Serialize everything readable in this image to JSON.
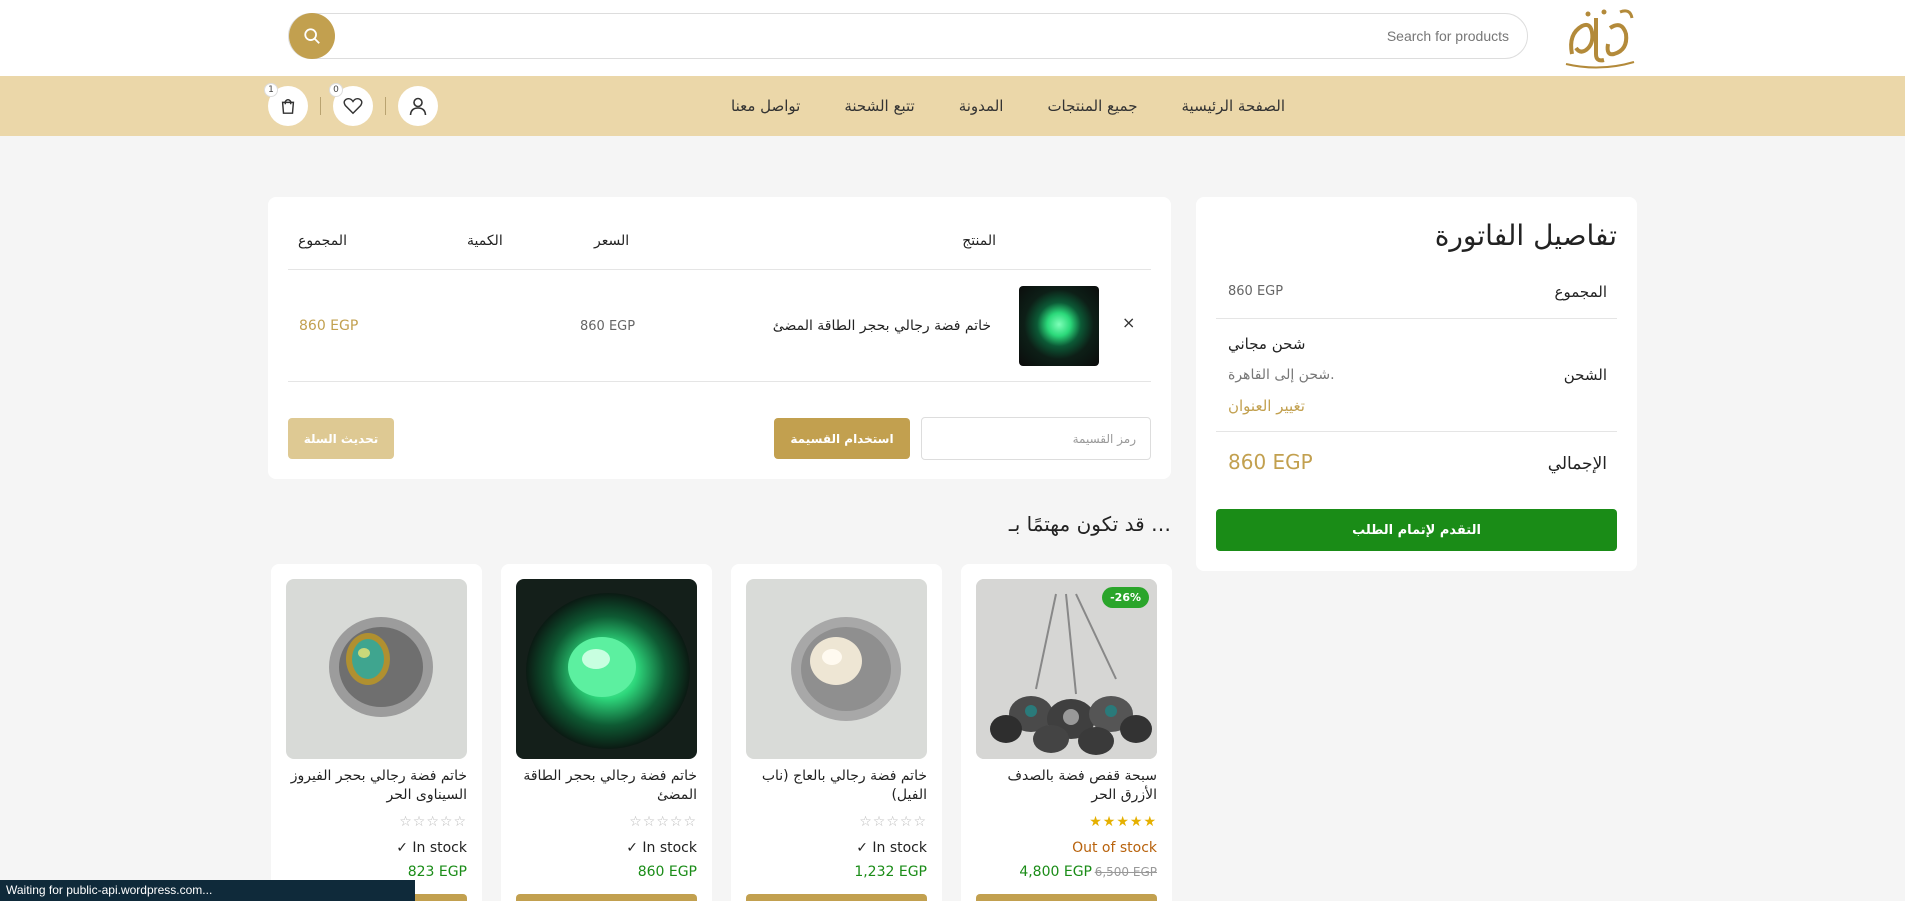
{
  "header": {
    "search_placeholder": "Search for products",
    "logo_text": "الغرقي"
  },
  "nav": {
    "items": [
      "الصفحة الرئيسية",
      "جميع المنتجات",
      "المدونة",
      "تتبع الشحنة",
      "تواصل معنا"
    ],
    "wishlist_count": "0",
    "cart_count": "1"
  },
  "cart": {
    "headers": {
      "product": "المنتج",
      "price": "السعر",
      "quantity": "الكمية",
      "subtotal": "المجموع"
    },
    "item": {
      "name": "خاتم فضة رجالي بحجر الطاقة المضئ",
      "price": "860 EGP",
      "subtotal": "860 EGP",
      "remove": "×"
    },
    "coupon_placeholder": "رمز القسيمة",
    "apply_label": "استخدام القسيمة",
    "update_label": "تحديث السلة"
  },
  "invoice": {
    "title": "تفاصيل الفاتورة",
    "subtotal_label": "المجموع",
    "subtotal_value": "860 EGP",
    "shipping_label": "الشحن",
    "shipping_method": "شحن مجاني",
    "shipping_to": "شحن إلى القاهرة.",
    "change_address": "تغيير العنوان",
    "total_label": "الإجمالي",
    "total_value": "860 EGP",
    "checkout_label": "التقدم لإتمام الطلب"
  },
  "related": {
    "title": "قد تكون مهتمًا بـ …",
    "products": [
      {
        "name": "سبحة قفص فضة بالصدف الأزرق الحر",
        "badge": "-26%",
        "rating": "★★★★★",
        "stock": "Out of stock",
        "price": "4,800 EGP",
        "old_price": "6,500 EGP"
      },
      {
        "name": "خاتم فضة رجالي بالعاج (ناب الفيل)",
        "rating": "☆☆☆☆☆",
        "stock": "✓ In stock",
        "price": "1,232 EGP"
      },
      {
        "name": "خاتم فضة رجالي بحجر الطاقة المضئ",
        "rating": "☆☆☆☆☆",
        "stock": "✓ In stock",
        "price": "860 EGP"
      },
      {
        "name": "خاتم فضة رجالي بحجر الفيروز السيناوى الحر",
        "rating": "☆☆☆☆☆",
        "stock": "✓ In stock",
        "price": "823 EGP"
      }
    ]
  },
  "status_bar": "Waiting for public-api.wordpress.com..."
}
